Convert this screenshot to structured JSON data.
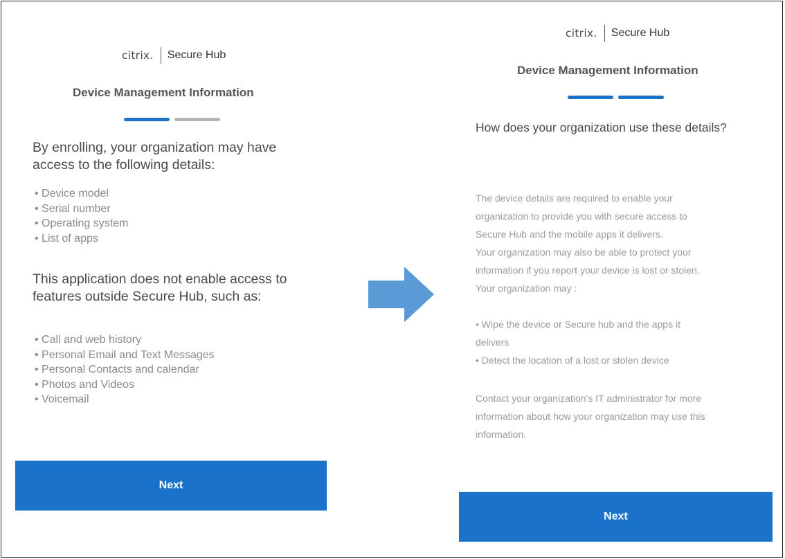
{
  "colors": {
    "accent": "#1a73c9",
    "inactive_step": "#b5b5b5",
    "arrow": "#5b9bd5"
  },
  "left": {
    "brand": {
      "logo": "citrix.",
      "product": "Secure Hub"
    },
    "title": "Device Management Information",
    "progress": {
      "current_step": 1,
      "total_steps": 2
    },
    "heading1": [
      "By enrolling, your organization may have",
      "access to the following details:"
    ],
    "details": [
      "Device model",
      "Serial number",
      "Operating system",
      "List of apps"
    ],
    "heading2": [
      "This application does not enable access to",
      "features outside Secure Hub, such as:"
    ],
    "no_access": [
      "Call and web history",
      "Personal Email and Text Messages",
      "Personal Contacts and calendar",
      "Photos and Videos",
      "Voicemail"
    ],
    "next_label": "Next"
  },
  "arrow_icon": "right-arrow-icon",
  "right": {
    "brand": {
      "logo": "citrix.",
      "product": "Secure Hub"
    },
    "title": "Device Management Information",
    "progress": {
      "current_step": 2,
      "total_steps": 2
    },
    "question": "How does your organization use these details?",
    "body_lines": [
      "The device details are required to enable your",
      "organization to provide you with secure access to",
      "Secure Hub and the mobile apps it delivers.",
      "Your organization may also be able to protect your",
      "information if you report your device is lost or stolen.",
      "Your organization may :"
    ],
    "actions_lines": [
      " • Wipe the device or Secure hub and the apps it",
      "delivers",
      " • Detect the location of a lost or stolen device"
    ],
    "contact_lines": [
      "Contact your organization's IT administrator for more",
      "information about how your organization may use this",
      "information."
    ],
    "next_label": "Next"
  }
}
